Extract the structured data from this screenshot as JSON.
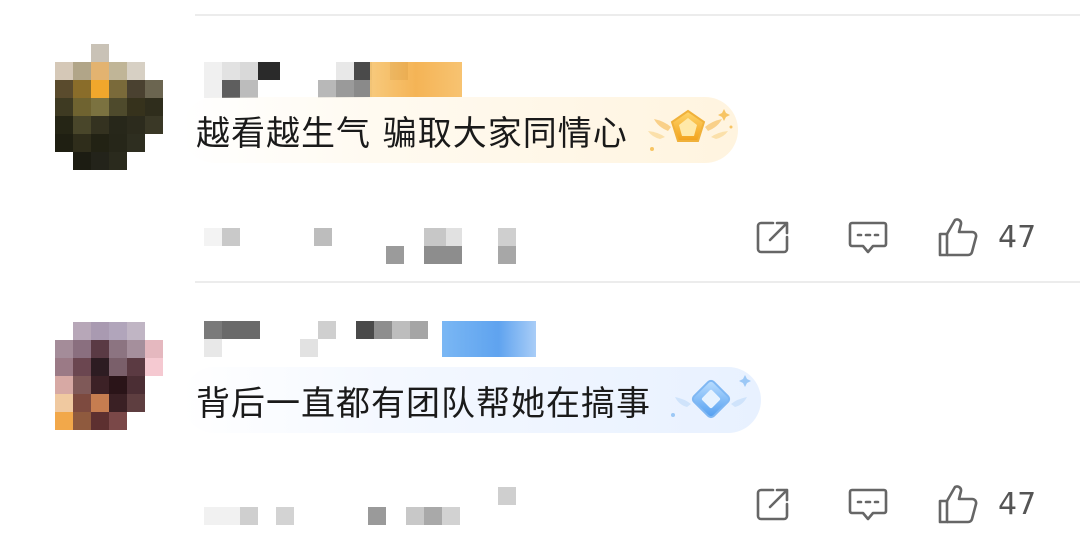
{
  "comments": [
    {
      "text": "越看越生气 骗取大家同情心",
      "badge": "gold-pentagon-medal-icon",
      "like_count": "47",
      "theme_color": "#f4b04d"
    },
    {
      "text": "背后一直都有团队帮她在搞事",
      "badge": "blue-diamond-medal-icon",
      "like_count": "47",
      "theme_color": "#5fa3ef"
    }
  ],
  "icons": {
    "share": "share-icon",
    "reply": "reply-icon",
    "like": "thumbs-up-icon"
  },
  "colors": {
    "text": "#1a1a1a",
    "action_icon": "#666666",
    "divider": "#ececec"
  }
}
